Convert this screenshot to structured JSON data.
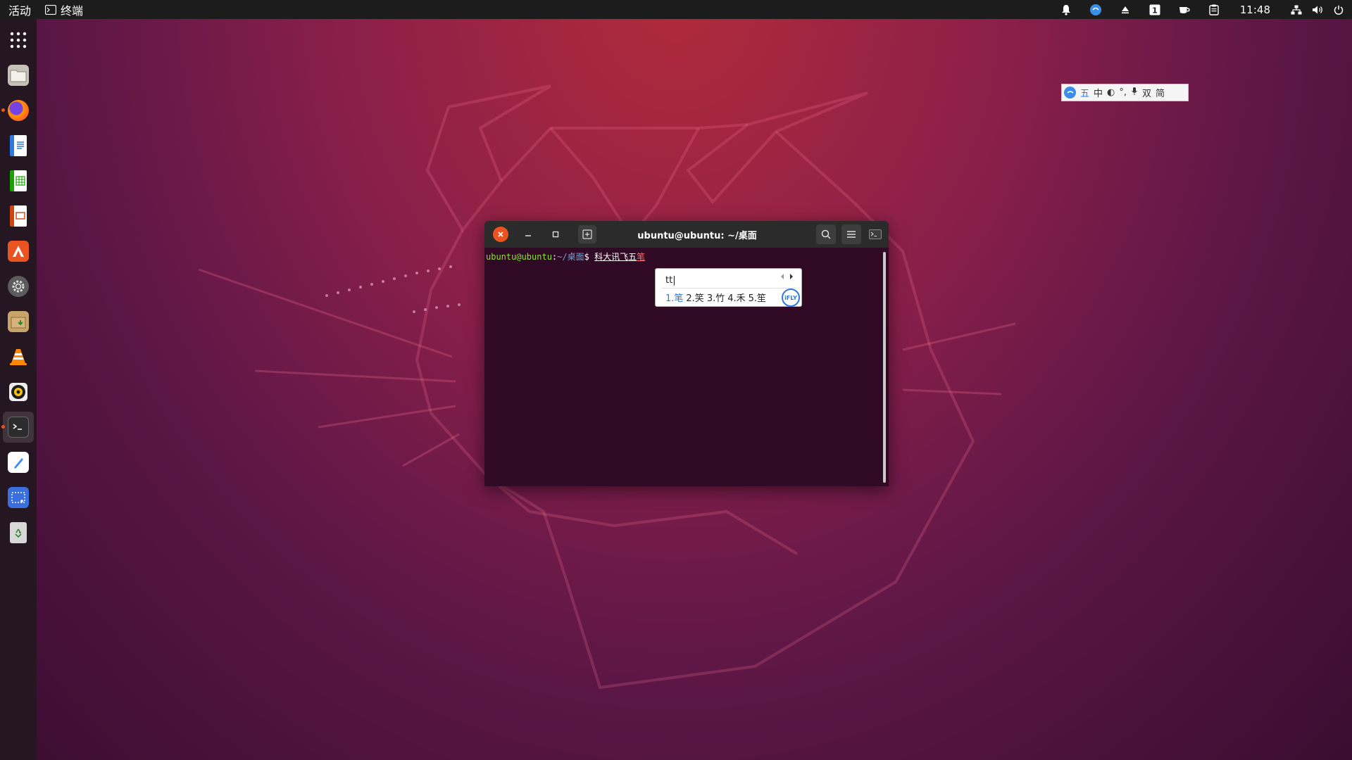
{
  "topbar": {
    "activities": "活动",
    "app_name": "终端",
    "clock": "11:48"
  },
  "dock": {
    "items": [
      {
        "name": "app-grid"
      },
      {
        "name": "files"
      },
      {
        "name": "firefox"
      },
      {
        "name": "writer"
      },
      {
        "name": "calc"
      },
      {
        "name": "impress"
      },
      {
        "name": "software"
      },
      {
        "name": "settings"
      },
      {
        "name": "archive"
      },
      {
        "name": "vlc"
      },
      {
        "name": "rhythmbox"
      },
      {
        "name": "terminal"
      },
      {
        "name": "text-editor"
      },
      {
        "name": "screenshot"
      },
      {
        "name": "trash"
      }
    ]
  },
  "ime_status": {
    "mode": "五",
    "lang": "中",
    "fullwidth": "◐",
    "punct": "°,",
    "voice": "🎤",
    "double": "双",
    "simp": "简"
  },
  "terminal": {
    "title": "ubuntu@ubuntu: ~/桌面",
    "prompt_user": "ubuntu@ubuntu",
    "prompt_sep": ":",
    "prompt_path": "~/桌面",
    "prompt_symbol": "$",
    "preedit_text": "科大讯飞五",
    "preedit_last": "笔"
  },
  "ime_popup": {
    "input": "tt|",
    "candidates": [
      "1.笔",
      "2.笑",
      "3.竹",
      "4.禾",
      "5.笙"
    ],
    "brand": "iFLY"
  }
}
